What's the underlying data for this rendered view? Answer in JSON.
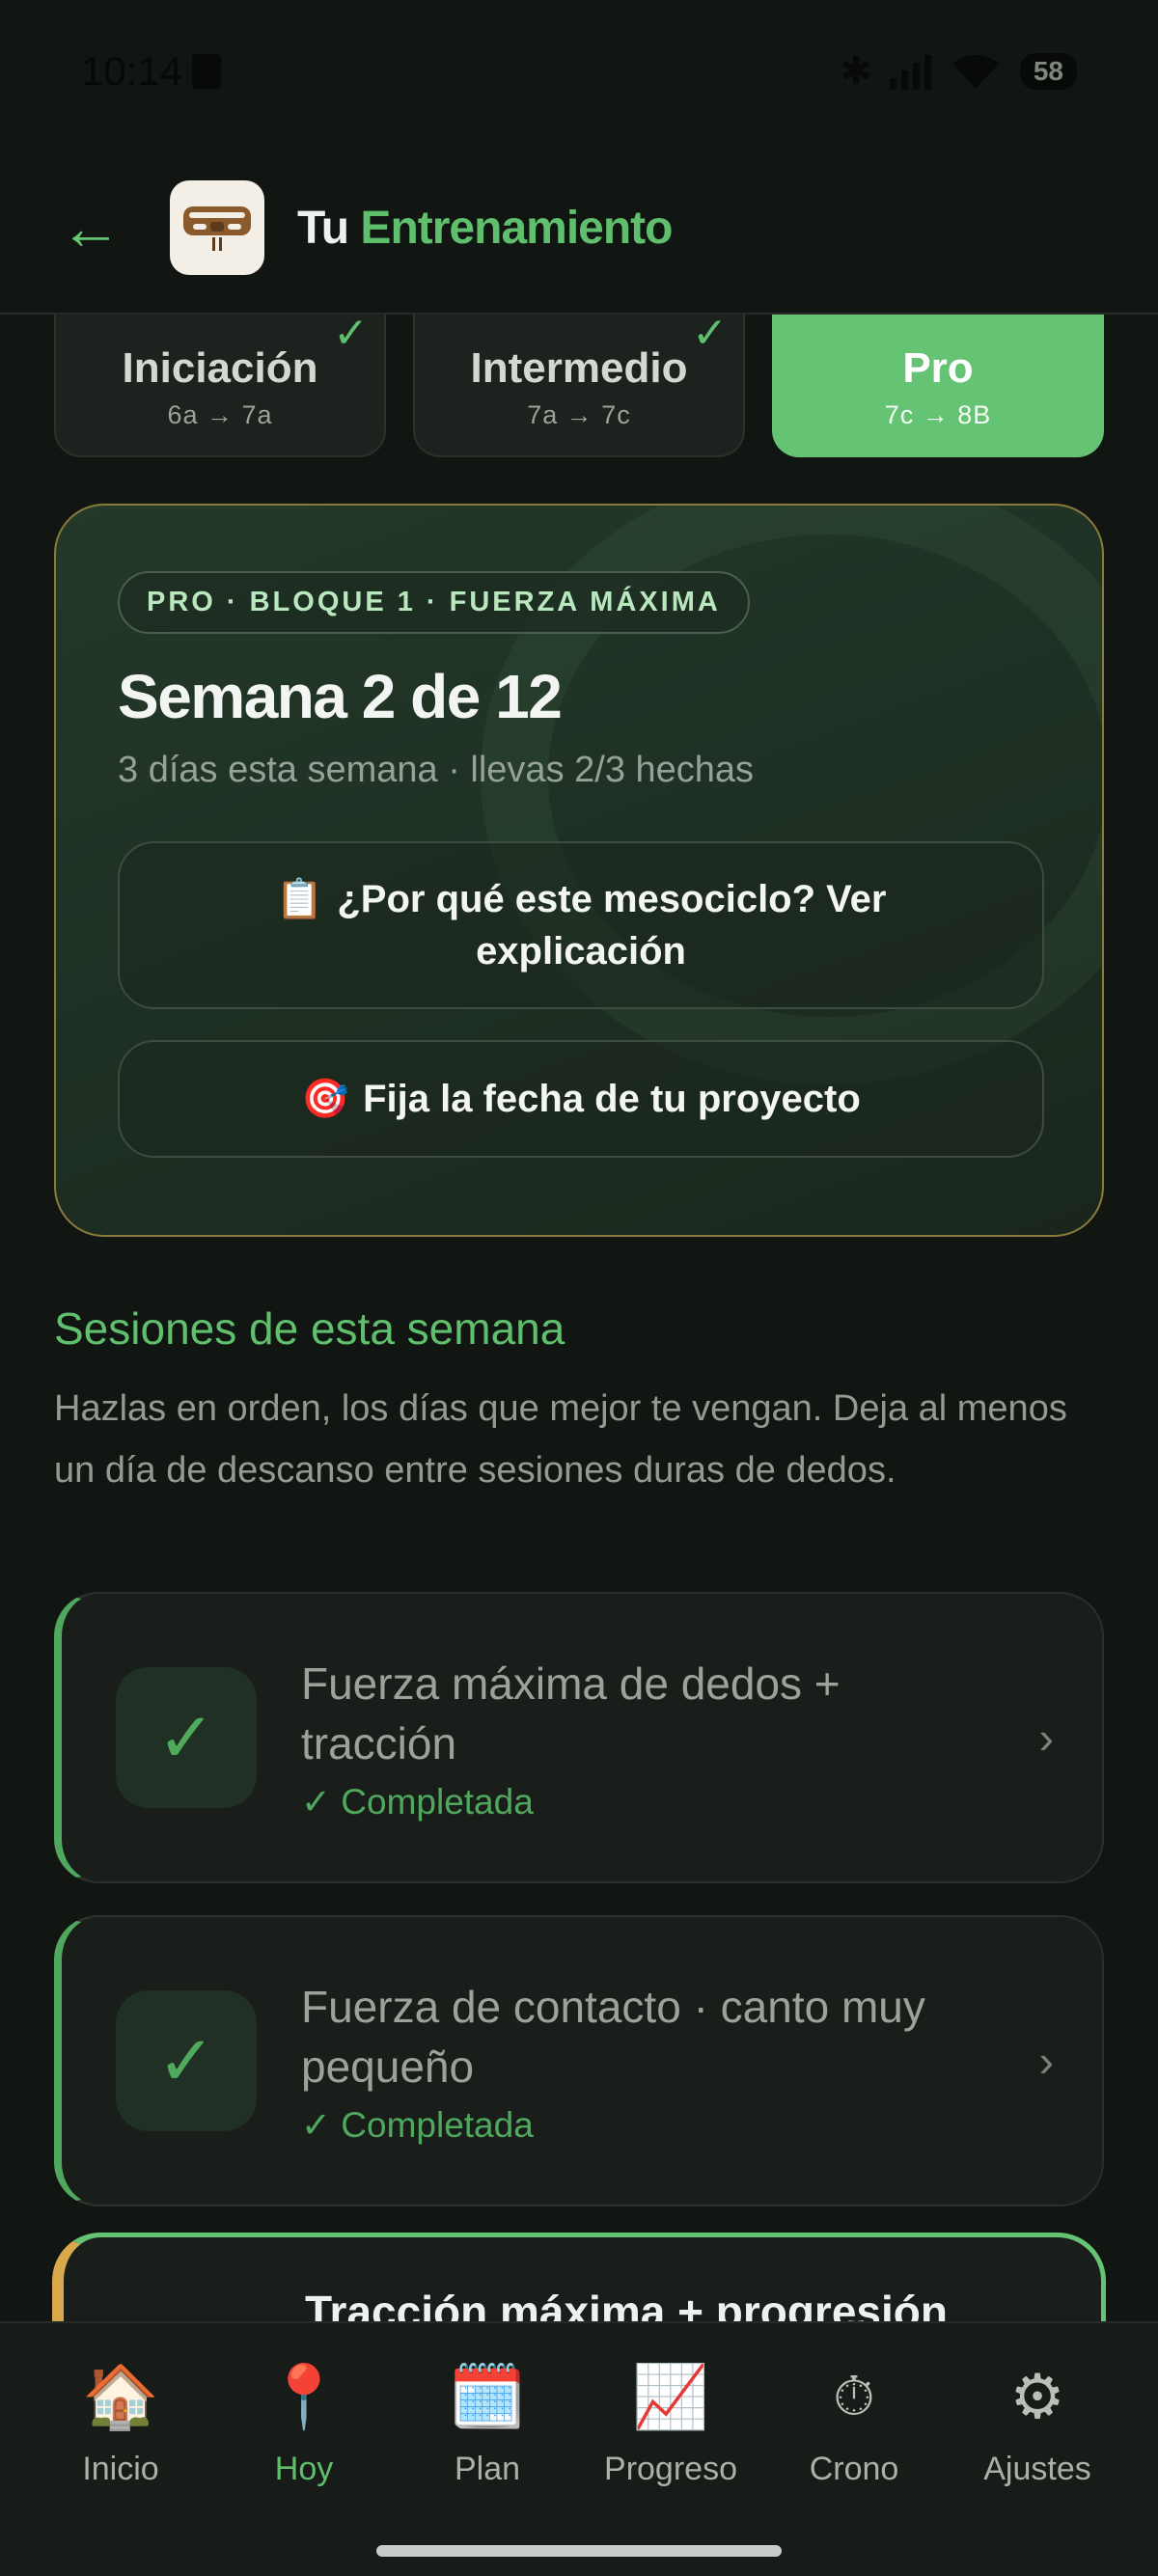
{
  "status_bar": {
    "time": "10:14",
    "battery": "58"
  },
  "header": {
    "back_icon": "←",
    "title_plain": "Tu",
    "title_accent": "Entrenamiento"
  },
  "levels": [
    {
      "name": "Iniciación",
      "range": "6a → 7a",
      "completed": true
    },
    {
      "name": "Intermedio",
      "range": "7a → 7c",
      "completed": true
    },
    {
      "name": "Pro",
      "range": "7c → 8B",
      "completed": false,
      "active": true
    }
  ],
  "check_glyph": "✓",
  "hero": {
    "badge": "PRO · BLOQUE 1 · FUERZA MÁXIMA",
    "week_title": "Semana 2 de 12",
    "week_sub": "3 días esta semana · llevas 2/3 hechas",
    "why_emoji": "📋",
    "why_label": "¿Por qué este mesociclo? Ver explicación",
    "date_emoji": "🎯",
    "date_label": "Fija la fecha de tu proyecto"
  },
  "sessions_section": {
    "title": "Sesiones de esta semana",
    "description": "Hazlas en orden, los días que mejor te vengan. Deja al menos un día de descanso entre sesiones duras de dedos."
  },
  "sessions": [
    {
      "title": "Fuerza máxima de dedos + tracción",
      "status": "✓ Completada"
    },
    {
      "title": "Fuerza de contacto · canto muy pequeño",
      "status": "✓ Completada"
    },
    {
      "title": "Tracción máxima + progresión"
    }
  ],
  "chevron": "›",
  "nav": [
    {
      "icon": "🏠",
      "label": "Inicio"
    },
    {
      "icon": "📍",
      "label": "Hoy",
      "active": true
    },
    {
      "icon": "🗓️",
      "label": "Plan"
    },
    {
      "icon": "📈",
      "label": "Progreso"
    },
    {
      "icon": "⏱",
      "label": "Crono"
    },
    {
      "icon": "⚙",
      "label": "Ajustes"
    }
  ],
  "colors": {
    "accent": "#5fbf6d",
    "active_tab": "#64c474",
    "hero_border": "#8a7a3c",
    "background": "#121613"
  }
}
